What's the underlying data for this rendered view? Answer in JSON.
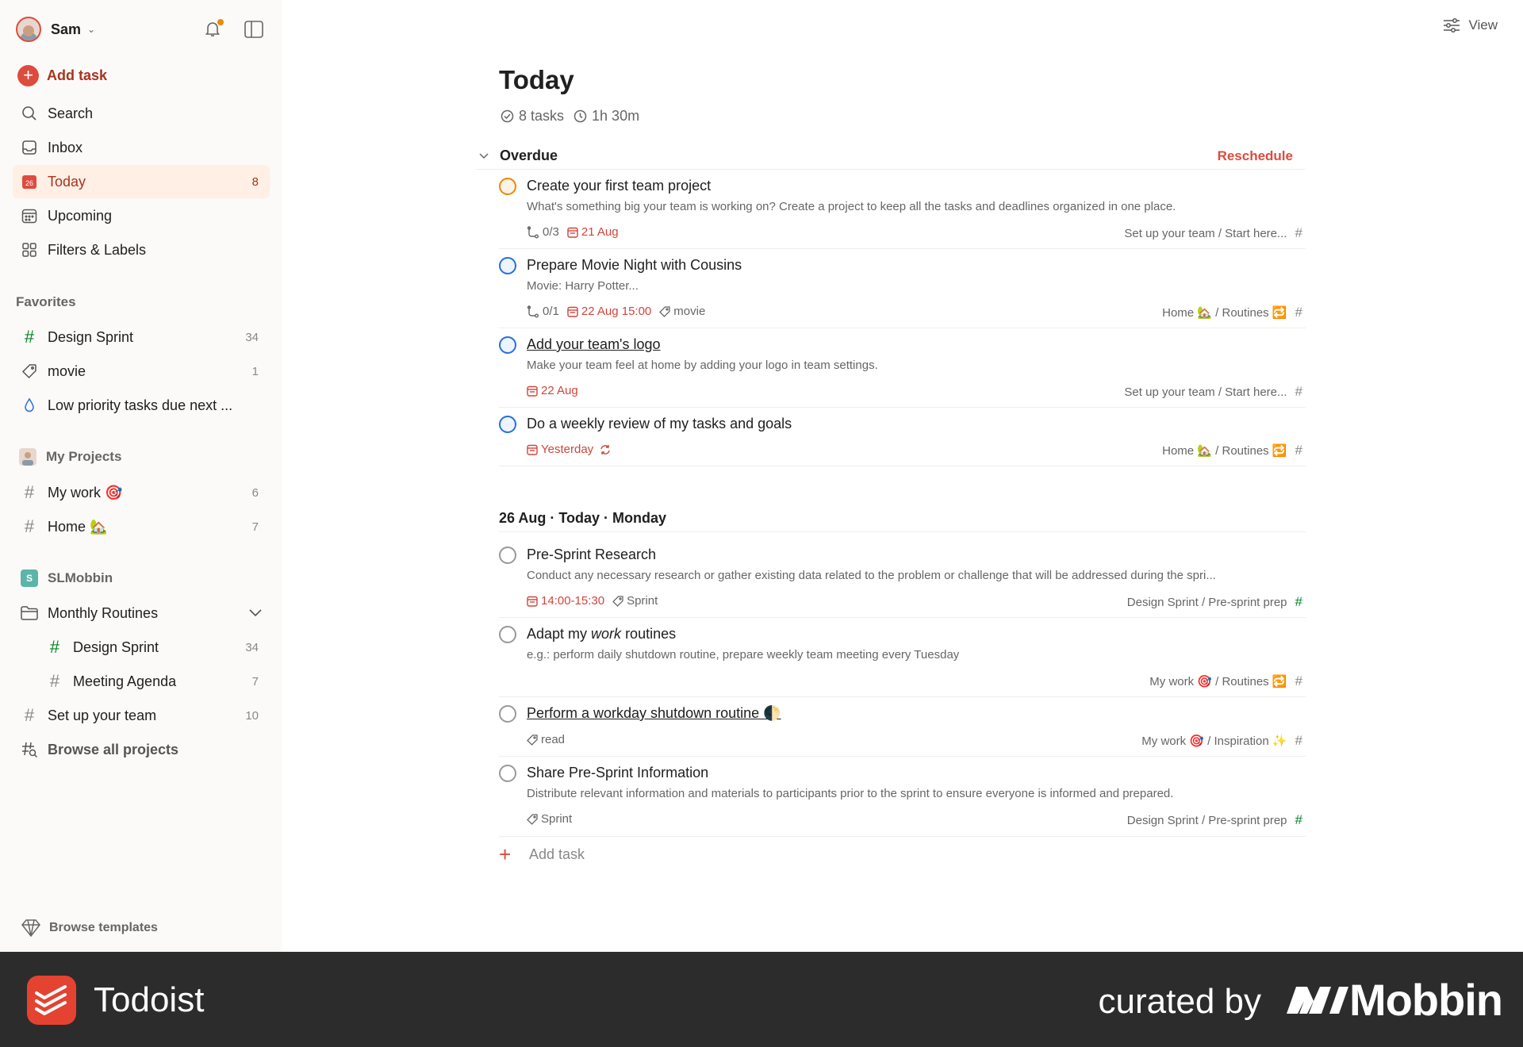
{
  "user": {
    "name": "Sam"
  },
  "sidebar": {
    "add_task": "Add task",
    "nav": [
      {
        "label": "Search",
        "count": "",
        "icon": "search-icon"
      },
      {
        "label": "Inbox",
        "count": "",
        "icon": "inbox-icon"
      },
      {
        "label": "Today",
        "count": "8",
        "icon": "calendar-today-icon",
        "active": true
      },
      {
        "label": "Upcoming",
        "count": "",
        "icon": "calendar-grid-icon"
      },
      {
        "label": "Filters & Labels",
        "count": "",
        "icon": "grid-icon"
      }
    ],
    "favorites_title": "Favorites",
    "favorites": [
      {
        "label": "Design Sprint",
        "count": "34"
      },
      {
        "label": "movie",
        "count": "1"
      },
      {
        "label": "Low priority tasks due next ...",
        "count": ""
      }
    ],
    "my_projects_title": "My Projects",
    "my_projects": [
      {
        "label": "My work 🎯",
        "count": "6"
      },
      {
        "label": "Home 🏡",
        "count": "7"
      }
    ],
    "workspace_title": "SLMobbin",
    "workspace_badge": "S",
    "workspace_items": [
      {
        "label": "Monthly Routines",
        "count": ""
      },
      {
        "label": "Design Sprint",
        "count": "34"
      },
      {
        "label": "Meeting Agenda",
        "count": "7"
      },
      {
        "label": "Set up your team",
        "count": "10"
      },
      {
        "label": "Browse all projects",
        "count": ""
      }
    ],
    "browse_templates": "Browse templates"
  },
  "header": {
    "view": "View"
  },
  "page": {
    "title": "Today",
    "tasks_count": "8 tasks",
    "duration": "1h 30m"
  },
  "overdue": {
    "title": "Overdue",
    "reschedule": "Reschedule",
    "tasks": [
      {
        "title": "Create your first team project",
        "description": "What's something big your team is working on? Create a project to keep all the tasks and deadlines organized in one place.",
        "subtasks": "0/3",
        "date": "21 Aug",
        "label": "",
        "project": "Set up your team / Start here..."
      },
      {
        "title": "Prepare Movie Night with Cousins",
        "description": "Movie: Harry Potter...",
        "subtasks": "0/1",
        "date": "22 Aug 15:00",
        "label": "movie",
        "project": "Home 🏡 / Routines 🔁"
      },
      {
        "title": "Add your team's logo",
        "description": "Make your team feel at home by adding your logo in team settings.",
        "subtasks": "",
        "date": "22 Aug",
        "label": "",
        "project": "Set up your team / Start here..."
      },
      {
        "title": "Do a weekly review of my tasks and goals",
        "description": "",
        "subtasks": "",
        "date": "Yesterday",
        "label": "",
        "project": "Home 🏡 / Routines 🔁"
      }
    ]
  },
  "today_section": {
    "title": "26 Aug · Today · Monday",
    "tasks": [
      {
        "title": "Pre-Sprint Research",
        "description": "Conduct any necessary research or gather existing data related to the problem or challenge that will be addressed during the spri...",
        "time": "14:00-15:30",
        "label": "Sprint",
        "project": "Design Sprint / Pre-sprint prep"
      },
      {
        "title_pre": "Adapt my ",
        "title_em": "work",
        "title_post": " routines",
        "description": "e.g.: perform daily shutdown routine, prepare weekly team meeting every Tuesday",
        "project": "My work 🎯 / Routines 🔁"
      },
      {
        "title": "Perform a workday shutdown routine 🌓",
        "label": "read",
        "project": "My work 🎯 / Inspiration ✨"
      },
      {
        "title": "Share Pre-Sprint Information",
        "description": "Distribute relevant information and materials to participants prior to the sprint to ensure everyone is informed and prepared.",
        "label": "Sprint",
        "project": "Design Sprint / Pre-sprint prep"
      }
    ],
    "add_task": "Add task"
  },
  "footer": {
    "app_name": "Todoist",
    "curated_by": "curated by",
    "brand": "Mobbin"
  },
  "colors": {
    "accent": "#dc4c3e",
    "active_bg": "#ffefe5",
    "sidebar_bg": "#fcfaf8",
    "footer_bg": "#2c2c2c"
  }
}
